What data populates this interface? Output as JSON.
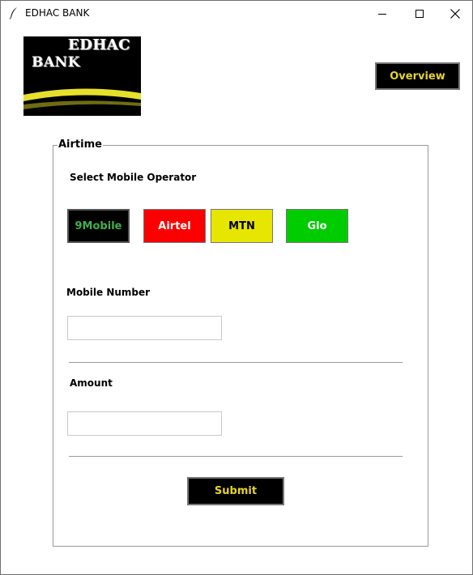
{
  "window": {
    "title": "EDHAC BANK"
  },
  "logo": {
    "line1": "EDHAC",
    "line2": "BANK",
    "accent_color": "#e6e02a"
  },
  "header": {
    "overview_label": "Overview"
  },
  "airtime": {
    "group_label": "Airtime",
    "operator_prompt": "Select Mobile Operator",
    "operators": [
      {
        "label": "9Mobile",
        "bg": "#000000",
        "fg": "#3fb24a"
      },
      {
        "label": "Airtel",
        "bg": "#fa0000",
        "fg": "#ffffff"
      },
      {
        "label": "MTN",
        "bg": "#e6e600",
        "fg": "#000000"
      },
      {
        "label": "Glo",
        "bg": "#00cc00",
        "fg": "#ffffff"
      }
    ],
    "mobile_number_label": "Mobile Number",
    "mobile_number_value": "",
    "amount_label": "Amount",
    "amount_value": "",
    "submit_label": "Submit"
  },
  "theme": {
    "button_bg": "#000000",
    "button_fg": "#e6d42a"
  }
}
